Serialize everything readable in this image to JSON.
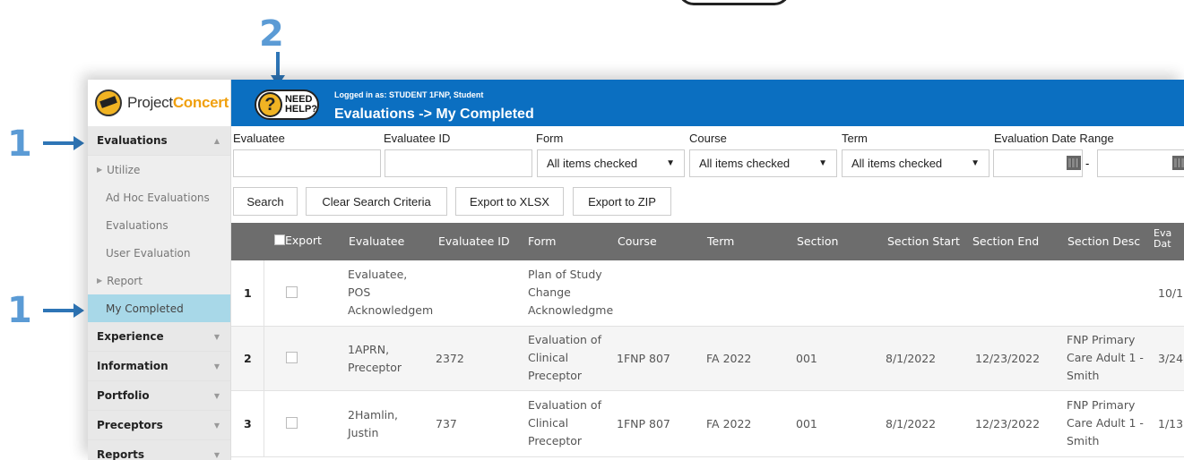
{
  "annotations": {
    "left_marker_1": "1",
    "left_marker_2": "1",
    "top_marker": "2"
  },
  "logo": {
    "text_plain": "Project",
    "text_accent": "Concert"
  },
  "help": {
    "symbol": "?",
    "line1": "NEED",
    "line2": "HELP?"
  },
  "header": {
    "logged_in": "Logged in as: STUDENT 1FNP, Student",
    "title": "Evaluations -> My Completed",
    "bg_color": "#0b6fc1"
  },
  "sidebar": {
    "evaluations": "Evaluations",
    "utilize": "Utilize",
    "ad_hoc": "Ad Hoc Evaluations",
    "evaluations_item": "Evaluations",
    "user_evaluation": "User Evaluation",
    "report": "Report",
    "my_completed": "My Completed",
    "experience": "Experience",
    "information": "Information",
    "portfolio": "Portfolio",
    "preceptors": "Preceptors",
    "reports": "Reports"
  },
  "filters": {
    "evaluatee_label": "Evaluatee",
    "evaluatee_id_label": "Evaluatee ID",
    "form_label": "Form",
    "course_label": "Course",
    "term_label": "Term",
    "date_range_label": "Evaluation Date Range",
    "form_value": "All items checked",
    "course_value": "All items checked",
    "term_value": "All items checked",
    "range_sep": "-"
  },
  "buttons": {
    "search": "Search",
    "clear": "Clear Search Criteria",
    "export_xlsx": "Export to XLSX",
    "export_zip": "Export to ZIP"
  },
  "table": {
    "headers": {
      "export": "Export",
      "evaluatee": "Evaluatee",
      "evaluatee_id": "Evaluatee ID",
      "form": "Form",
      "course": "Course",
      "term": "Term",
      "section": "Section",
      "section_start": "Section Start",
      "section_end": "Section End",
      "section_desc": "Section Desc",
      "eval_date_1": "Eva",
      "eval_date_2": "Dat"
    },
    "rows": [
      {
        "num": "1",
        "evaluatee": [
          "Evaluatee,",
          "POS",
          "Acknowledgem"
        ],
        "evaluatee_id": "",
        "form": [
          "Plan of Study",
          "Change",
          "Acknowledgme"
        ],
        "course": "",
        "term": "",
        "section": "",
        "section_start": "",
        "section_end": "",
        "section_desc": [
          "",
          "",
          ""
        ],
        "eval_date": "10/1"
      },
      {
        "num": "2",
        "evaluatee": [
          "1APRN,",
          "Preceptor"
        ],
        "evaluatee_id": "2372",
        "form": [
          "Evaluation of",
          "Clinical",
          "Preceptor"
        ],
        "course": "1FNP 807",
        "term": "FA 2022",
        "section": "001",
        "section_start": "8/1/2022",
        "section_end": "12/23/2022",
        "section_desc": [
          "FNP Primary",
          "Care Adult 1 -",
          "Smith"
        ],
        "eval_date": "3/24"
      },
      {
        "num": "3",
        "evaluatee": [
          "2Hamlin,",
          "Justin"
        ],
        "evaluatee_id": "737",
        "form": [
          "Evaluation of",
          "Clinical",
          "Preceptor"
        ],
        "course": "1FNP 807",
        "term": "FA 2022",
        "section": "001",
        "section_start": "8/1/2022",
        "section_end": "12/23/2022",
        "section_desc": [
          "FNP Primary",
          "Care Adult 1 -",
          "Smith"
        ],
        "eval_date": "1/13"
      }
    ]
  }
}
